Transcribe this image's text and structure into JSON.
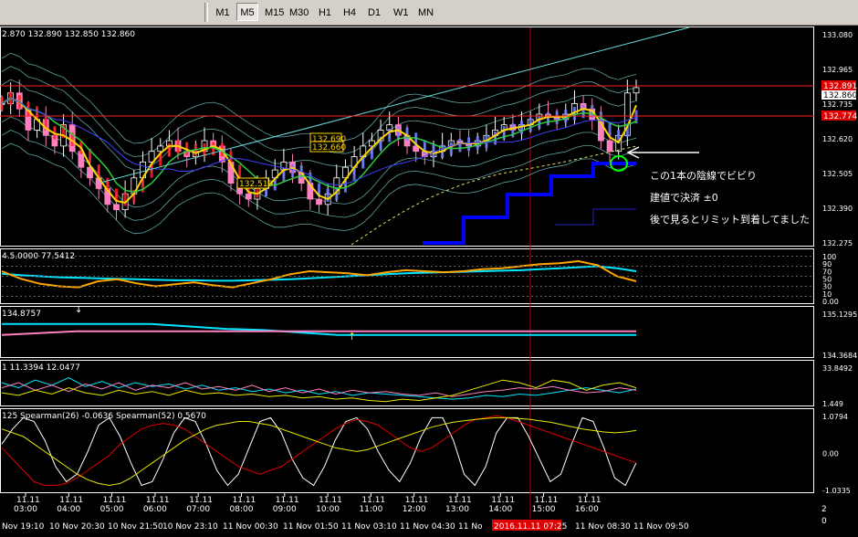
{
  "toolbar": {
    "timeframes": [
      "M1",
      "M5",
      "M15",
      "M30",
      "H1",
      "H4",
      "D1",
      "W1",
      "MN"
    ],
    "active": "M5"
  },
  "colors": {
    "background": "#000000",
    "panel_border": "#ffffff",
    "up_candle": "#ffffff",
    "ema_fast": "#ffd400",
    "ema_mid": "#2ecc40",
    "bollinger": "#5fa0a0",
    "trend_line": "#66d9d9",
    "price_line_red": "#ff2020",
    "trailing_stop": "#0000ff",
    "heiken_red": "#ff2020",
    "heiken_blue": "#6f7fff",
    "rsi_cyan": "#00e5ff",
    "rsi_orange": "#ffa500",
    "ma_pink": "#ff80c0",
    "spearman_white": "#ffffff",
    "spearman_red": "#e00000",
    "spearman_yellow": "#e8e800",
    "highlight_circle": "#00ff00",
    "arrow": "#ffffff"
  },
  "chart_data": [
    {
      "type": "line",
      "panel": "price",
      "header": "2.870 132.890 132.850 132.860",
      "y_ticks": [
        "133.080",
        "132.965",
        "132.735",
        "132.620",
        "132.505",
        "132.390",
        "132.275"
      ],
      "price_tags": [
        {
          "value": "132.891",
          "kind": "bid-red"
        },
        {
          "value": "132.860",
          "kind": "current"
        },
        {
          "value": "132.774",
          "kind": "red"
        }
      ],
      "price_labels": [
        "132.690",
        "132.660",
        "132.510"
      ],
      "ylim": [
        132.275,
        133.08
      ],
      "close": [
        132.8,
        132.84,
        132.78,
        132.7,
        132.74,
        132.68,
        132.64,
        132.72,
        132.62,
        132.56,
        132.52,
        132.48,
        132.42,
        132.4,
        132.46,
        132.52,
        132.58,
        132.62,
        132.64,
        132.66,
        132.62,
        132.6,
        132.62,
        132.66,
        132.64,
        132.58,
        132.5,
        132.46,
        132.44,
        132.48,
        132.52,
        132.55,
        132.58,
        132.54,
        132.5,
        132.44,
        132.42,
        132.46,
        132.52,
        132.56,
        132.6,
        132.64,
        132.66,
        132.7,
        132.72,
        132.68,
        132.64,
        132.62,
        132.6,
        132.62,
        132.64,
        132.66,
        132.65,
        132.64,
        132.66,
        132.68,
        132.7,
        132.72,
        132.7,
        132.72,
        132.74,
        132.76,
        132.75,
        132.74,
        132.76,
        132.8,
        132.78,
        132.74,
        132.66,
        132.62,
        132.68,
        132.84,
        132.86
      ]
    },
    {
      "type": "line",
      "panel": "rsi",
      "header": "4.5.0000 77.5412",
      "y_ticks": [
        "100",
        "90",
        "70",
        "50",
        "30",
        "10",
        "0.00"
      ],
      "ylim": [
        0,
        100
      ],
      "series": [
        {
          "color": "rsi_cyan",
          "values": [
            55,
            52,
            50,
            48,
            47,
            46,
            45,
            44,
            43,
            42,
            42,
            41,
            41,
            42,
            43,
            44,
            46,
            48,
            50,
            52,
            54,
            56,
            57,
            58,
            59,
            60,
            61,
            62,
            64,
            66,
            68,
            70,
            66,
            60
          ]
        },
        {
          "color": "rsi_orange",
          "values": [
            60,
            45,
            35,
            30,
            28,
            40,
            44,
            36,
            30,
            34,
            38,
            32,
            28,
            36,
            44,
            54,
            60,
            58,
            56,
            52,
            58,
            62,
            60,
            58,
            60,
            64,
            66,
            70,
            74,
            76,
            80,
            72,
            50,
            40
          ]
        }
      ]
    },
    {
      "type": "line",
      "panel": "ma",
      "header": "134.8757",
      "y_ticks": [
        "135.1295",
        "134.3684"
      ],
      "ylim": [
        134.3684,
        135.1295
      ],
      "series": [
        {
          "color": "rsi_cyan",
          "values": [
            134.88,
            134.88,
            134.88,
            134.88,
            134.88,
            134.84,
            134.8,
            134.78,
            134.74,
            134.7,
            134.7,
            134.7,
            134.7,
            134.7,
            134.7,
            134.7,
            134.7,
            134.7
          ]
        },
        {
          "color": "ma_pink",
          "values": [
            134.7,
            134.73,
            134.76,
            134.76,
            134.76,
            134.76,
            134.76,
            134.76,
            134.76,
            134.76,
            134.76,
            134.76,
            134.76,
            134.76,
            134.76,
            134.76,
            134.76,
            134.76
          ]
        }
      ]
    },
    {
      "type": "line",
      "panel": "adx",
      "header": "1 11.3394 12.0477",
      "y_ticks": [
        "33.8492",
        "1.449"
      ],
      "ylim": [
        1.449,
        33.8492
      ],
      "series": [
        {
          "color": "rsi_cyan",
          "values": [
            18,
            14,
            20,
            16,
            22,
            15,
            19,
            14,
            18,
            15,
            17,
            13,
            16,
            12,
            14,
            11,
            13,
            10,
            12,
            9,
            11,
            8,
            10,
            9,
            8,
            7,
            6,
            5,
            6,
            8,
            7,
            9,
            8,
            10,
            12,
            14,
            12,
            10,
            13
          ]
        },
        {
          "color": "ma_pink",
          "values": [
            14,
            18,
            12,
            16,
            11,
            17,
            13,
            18,
            12,
            16,
            14,
            18,
            13,
            15,
            12,
            16,
            11,
            14,
            10,
            13,
            9,
            12,
            10,
            11,
            9,
            8,
            10,
            7,
            9,
            11,
            12,
            14,
            13,
            15,
            12,
            10,
            11,
            14,
            12
          ]
        },
        {
          "color": "spearman_yellow",
          "values": [
            10,
            8,
            12,
            9,
            14,
            10,
            8,
            12,
            9,
            11,
            8,
            12,
            9,
            10,
            8,
            9,
            7,
            8,
            6,
            7,
            5,
            6,
            4,
            3,
            5,
            4,
            6,
            8,
            12,
            16,
            20,
            18,
            14,
            20,
            18,
            12,
            16,
            18,
            14
          ]
        }
      ]
    },
    {
      "type": "line",
      "panel": "spearman",
      "header": "125 Spearman(26) -0.0636 Spearman(52) 0.5670",
      "y_ticks": [
        "1.0794",
        "0.00",
        "-1.0335"
      ],
      "ylim": [
        -1.0335,
        1.0794
      ],
      "series": [
        {
          "color": "spearman_white",
          "values": [
            0.2,
            0.6,
            0.9,
            0.8,
            0.3,
            -0.4,
            -0.8,
            -0.6,
            0.0,
            0.7,
            0.9,
            0.4,
            -0.3,
            -0.9,
            -0.8,
            -0.2,
            0.5,
            0.9,
            0.8,
            0.2,
            -0.5,
            -0.9,
            -0.6,
            0.1,
            0.8,
            0.9,
            0.5,
            -0.2,
            -0.7,
            -0.9,
            -0.4,
            0.3,
            0.8,
            0.9,
            0.6,
            0.0,
            -0.5,
            -0.8,
            -0.3,
            0.4,
            0.9,
            0.9,
            0.3,
            -0.6,
            -0.9,
            -0.4,
            0.5,
            0.9,
            0.9,
            0.4,
            -0.2,
            -0.8,
            -0.6,
            0.2,
            0.9,
            0.8,
            0.1,
            -0.7,
            -0.9,
            -0.3
          ]
        },
        {
          "color": "spearman_red",
          "values": [
            0.1,
            -0.2,
            -0.5,
            -0.8,
            -0.9,
            -0.9,
            -0.85,
            -0.7,
            -0.5,
            -0.3,
            -0.1,
            0.2,
            0.4,
            0.6,
            0.7,
            0.75,
            0.7,
            0.6,
            0.4,
            0.2,
            0.0,
            -0.2,
            -0.4,
            -0.5,
            -0.6,
            -0.5,
            -0.4,
            -0.2,
            0.0,
            0.2,
            0.4,
            0.6,
            0.75,
            0.85,
            0.8,
            0.7,
            0.5,
            0.3,
            0.1,
            0.0,
            0.1,
            0.3,
            0.5,
            0.7,
            0.85,
            0.9,
            0.95,
            0.9,
            0.8,
            0.7,
            0.6,
            0.5,
            0.4,
            0.3,
            0.2,
            0.1,
            0.0,
            -0.1,
            -0.2,
            -0.3
          ]
        },
        {
          "color": "spearman_yellow",
          "values": [
            0.6,
            0.5,
            0.4,
            0.2,
            0.0,
            -0.2,
            -0.4,
            -0.6,
            -0.75,
            -0.85,
            -0.9,
            -0.85,
            -0.7,
            -0.5,
            -0.3,
            -0.1,
            0.1,
            0.3,
            0.45,
            0.6,
            0.7,
            0.75,
            0.8,
            0.8,
            0.75,
            0.7,
            0.6,
            0.5,
            0.4,
            0.3,
            0.2,
            0.1,
            0.05,
            0.0,
            0.05,
            0.15,
            0.25,
            0.35,
            0.45,
            0.55,
            0.65,
            0.72,
            0.78,
            0.82,
            0.85,
            0.88,
            0.9,
            0.9,
            0.88,
            0.86,
            0.82,
            0.78,
            0.72,
            0.66,
            0.6,
            0.56,
            0.52,
            0.5,
            0.52,
            0.56
          ]
        }
      ]
    }
  ],
  "time_axis": {
    "top": [
      {
        "date": "11.11",
        "time": "03:00"
      },
      {
        "date": "11.11",
        "time": "04:00"
      },
      {
        "date": "11.11",
        "time": "05:00"
      },
      {
        "date": "11.11",
        "time": "06:00"
      },
      {
        "date": "11.11",
        "time": "07:00"
      },
      {
        "date": "11.11",
        "time": "08:00"
      },
      {
        "date": "11.11",
        "time": "09:00"
      },
      {
        "date": "11.11",
        "time": "10:00"
      },
      {
        "date": "11.11",
        "time": "11:00"
      },
      {
        "date": "11.11",
        "time": "12:00"
      },
      {
        "date": "11.11",
        "time": "13:00"
      },
      {
        "date": "11.11",
        "time": "14:00"
      },
      {
        "date": "11.11",
        "time": "15:00"
      },
      {
        "date": "11.11",
        "time": "16:00"
      }
    ],
    "bottom": [
      "Nov 19:10",
      "10 Nov 20:30",
      "10 Nov 21:50",
      "10 Nov 23:10",
      "11 Nov 00:30",
      "11 Nov 01:50",
      "11 Nov 03:10",
      "11 Nov 04:30",
      "11 No",
      "11 Nov 08:30",
      "11 Nov 09:50"
    ],
    "cursor_label": "2016.11.11 07:25",
    "corner": [
      "2",
      "0"
    ]
  },
  "annotations": [
    "この1本の陰線でビビり",
    "建値で決済 ±0",
    "後で見るとリミット到着してました"
  ]
}
